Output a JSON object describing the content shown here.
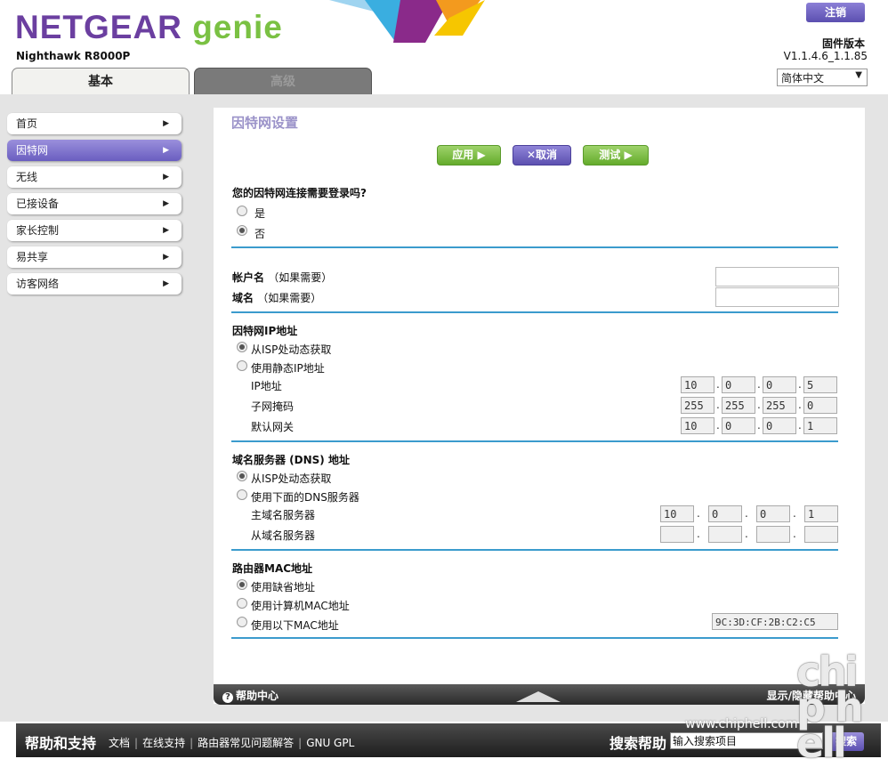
{
  "header": {
    "brand": "NETGEAR",
    "product": "genie",
    "model": "Nighthawk R8000P",
    "logout_label": "注销",
    "firmware_label": "固件版本",
    "firmware_version": "V1.1.4.6_1.1.85",
    "language": "简体中文",
    "tabs": [
      {
        "label": "基本"
      },
      {
        "label": "高级"
      }
    ]
  },
  "sidebar": {
    "items": [
      {
        "label": "首页"
      },
      {
        "label": "因特网"
      },
      {
        "label": "无线"
      },
      {
        "label": "已接设备"
      },
      {
        "label": "家长控制"
      },
      {
        "label": "易共享"
      },
      {
        "label": "访客网络"
      }
    ],
    "active": "因特网"
  },
  "main": {
    "title": "因特网设置",
    "buttons": {
      "apply": "应用 ▶",
      "cancel": "取消",
      "test": "测试 ▶"
    },
    "login_question": "您的因特网连接需要登录吗?",
    "login_yes": "是",
    "login_no": "否",
    "account_label": "帐户名",
    "domain_label": "域名",
    "if_needed": "（如果需要）",
    "ip_section": "因特网IP地址",
    "ip_dynamic": "从ISP处动态获取",
    "ip_static": "使用静态IP地址",
    "ip_addr_label": "IP地址",
    "subnet_label": "子网掩码",
    "gateway_label": "默认网关",
    "ip_addr": [
      "10",
      "0",
      "0",
      "5"
    ],
    "subnet": [
      "255",
      "255",
      "255",
      "0"
    ],
    "gateway": [
      "10",
      "0",
      "0",
      "1"
    ],
    "dns_section": "域名服务器 (DNS) 地址",
    "dns_dynamic": "从ISP处动态获取",
    "dns_manual": "使用下面的DNS服务器",
    "dns_primary_label": "主域名服务器",
    "dns_secondary_label": "从域名服务器",
    "dns_primary": [
      "10",
      "0",
      "0",
      "1"
    ],
    "mac_section": "路由器MAC地址",
    "mac_default": "使用缺省地址",
    "mac_computer": "使用计算机MAC地址",
    "mac_custom": "使用以下MAC地址",
    "mac_value": "9C:3D:CF:2B:C2:C5"
  },
  "helpbar": {
    "left": "帮助中心",
    "right": "显示/隐藏帮助中心"
  },
  "footer": {
    "title": "帮助和支持",
    "links": [
      "文档",
      "在线支持",
      "路由器常见问题解答",
      "GNU GPL"
    ],
    "search_label": "搜索帮助",
    "search_value": "输入搜索项目",
    "search_button": "搜索"
  },
  "watermark": {
    "text": "chip hell",
    "url": "www.chiphell.com"
  },
  "colors": {
    "accent": "#3b9bcd",
    "brand_purple": "#6b3fa0",
    "brand_green": "#7ac143"
  }
}
